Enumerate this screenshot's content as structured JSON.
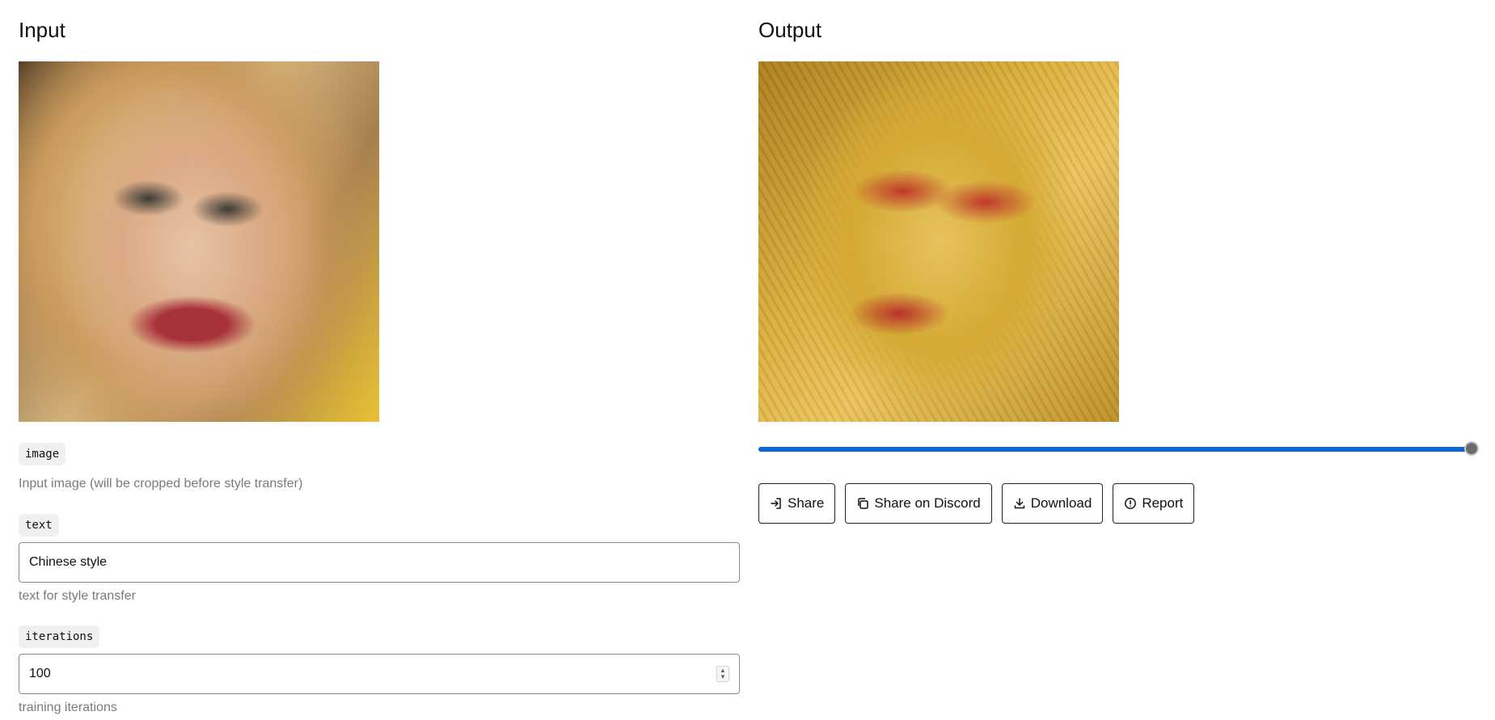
{
  "input": {
    "title": "Input",
    "image_field": {
      "tag": "image",
      "help": "Input image (will be cropped before style transfer)"
    },
    "text_field": {
      "tag": "text",
      "value": "Chinese style",
      "help": "text for style transfer"
    },
    "iterations_field": {
      "tag": "iterations",
      "value": "100",
      "help": "training iterations"
    }
  },
  "output": {
    "title": "Output",
    "slider": {
      "position_fraction": 1.0
    },
    "buttons": [
      {
        "label": "Share",
        "icon": "share-arrow-icon"
      },
      {
        "label": "Share on Discord",
        "icon": "copy-icon"
      },
      {
        "label": "Download",
        "icon": "download-icon"
      },
      {
        "label": "Report",
        "icon": "report-alert-icon"
      }
    ]
  },
  "colors": {
    "accent": "#0f66d8",
    "tag_background": "#f0f0f0",
    "help_text": "#7a7a7a"
  }
}
